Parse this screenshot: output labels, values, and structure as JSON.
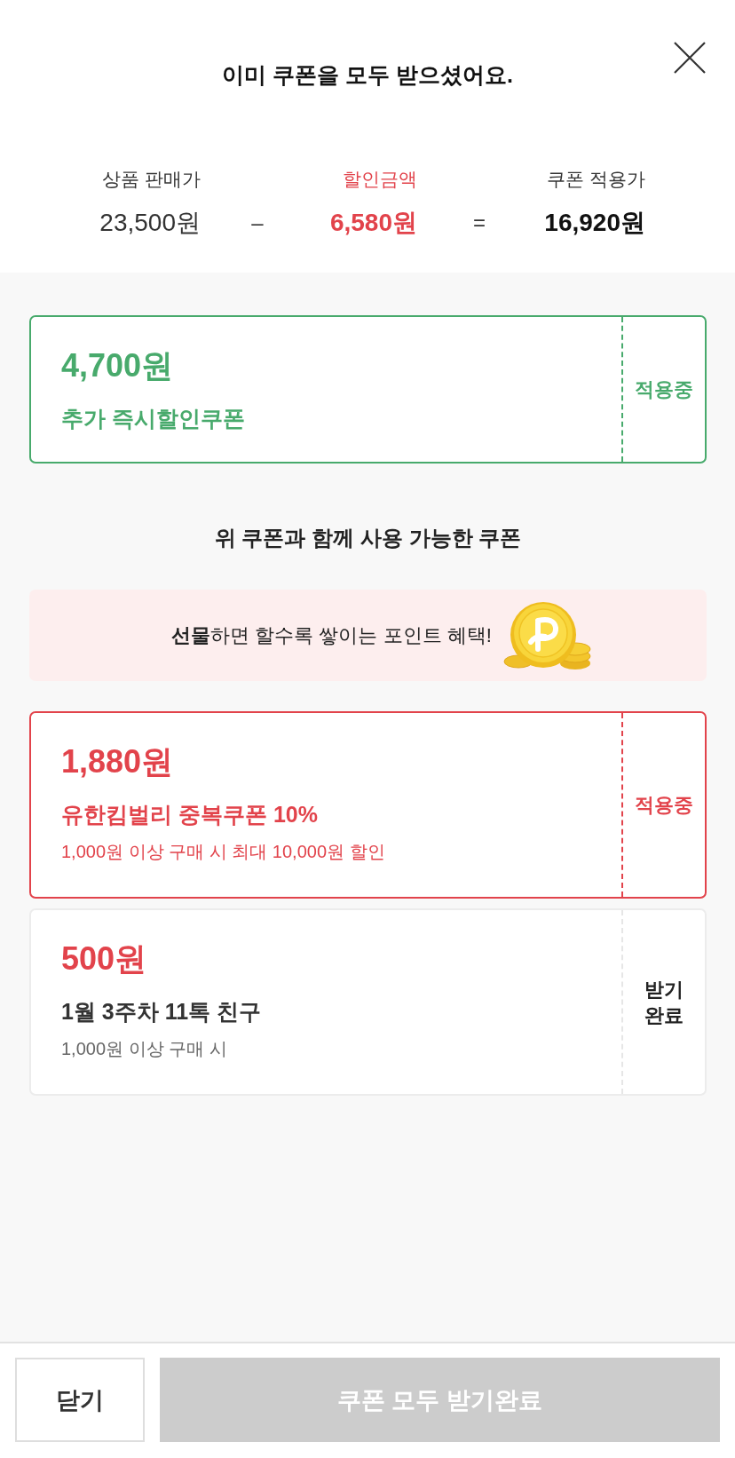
{
  "header": {
    "title": "이미 쿠폰을 모두 받으셨어요."
  },
  "price_summary": {
    "items": [
      {
        "kind": "base",
        "label": "상품 판매가",
        "value": "23,500원"
      },
      {
        "kind": "discount",
        "label": "할인금액",
        "value": "6,580원"
      },
      {
        "kind": "final",
        "label": "쿠폰 적용가",
        "value": "16,920원"
      }
    ],
    "operators": [
      "–",
      "="
    ]
  },
  "applied_coupon": {
    "kind": "instant",
    "amount": "4,700원",
    "name": "추가 즉시할인쿠폰",
    "status": "적용중"
  },
  "section_title": "위 쿠폰과 함께 사용 가능한 쿠폰",
  "promo_banner": {
    "text": "**선물**하면 할수록 쌓이는 포인트 혜택!"
  },
  "coupons": [
    {
      "amount": "1,880원",
      "name": "유한킴벌리 중복쿠폰 10%",
      "condition": "1,000원 이상 구매 시 최대 10,000원 할인",
      "status": "적용중",
      "applied": true
    },
    {
      "amount": "500원",
      "name": "1월 3주차 11톡 친구",
      "condition": "1,000원 이상 구매 시",
      "status": "받기 완료",
      "applied": false
    }
  ],
  "footer": {
    "buttons": [
      {
        "kind": "secondary",
        "label": "닫기",
        "disabled": false
      },
      {
        "kind": "primary",
        "label": "쿠폰 모두 받기완료",
        "disabled": true
      }
    ]
  }
}
